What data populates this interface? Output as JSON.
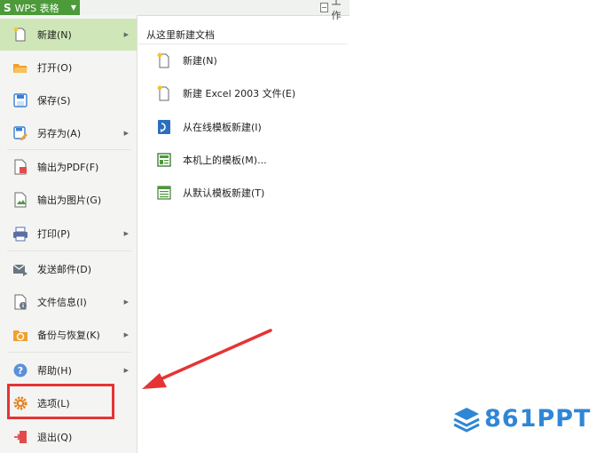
{
  "app": {
    "logo_letter": "S",
    "button_label": "WPS 表格",
    "right_label": "工作"
  },
  "menu": {
    "items": [
      {
        "label": "新建(N)",
        "icon": "new-doc-icon",
        "submenu": true
      },
      {
        "label": "打开(O)",
        "icon": "open-folder-icon",
        "submenu": false
      },
      {
        "label": "保存(S)",
        "icon": "save-icon",
        "submenu": false
      },
      {
        "label": "另存为(A)",
        "icon": "save-as-icon",
        "submenu": true
      },
      {
        "label": "输出为PDF(F)",
        "icon": "pdf-export-icon",
        "submenu": false
      },
      {
        "label": "输出为图片(G)",
        "icon": "image-export-icon",
        "submenu": false
      },
      {
        "label": "打印(P)",
        "icon": "printer-icon",
        "submenu": true
      },
      {
        "label": "发送邮件(D)",
        "icon": "mail-icon",
        "submenu": false
      },
      {
        "label": "文件信息(I)",
        "icon": "file-info-icon",
        "submenu": true
      },
      {
        "label": "备份与恢复(K)",
        "icon": "backup-icon",
        "submenu": true
      },
      {
        "label": "帮助(H)",
        "icon": "help-icon",
        "submenu": true
      },
      {
        "label": "选项(L)",
        "icon": "gear-icon",
        "submenu": false
      },
      {
        "label": "退出(Q)",
        "icon": "exit-icon",
        "submenu": false
      }
    ]
  },
  "panel": {
    "title": "从这里新建文档",
    "items": [
      {
        "label": "新建(N)",
        "icon": "new-doc-icon"
      },
      {
        "label": "新建 Excel 2003 文件(E)",
        "icon": "new-excel-icon"
      },
      {
        "label": "从在线模板新建(I)",
        "icon": "online-template-icon"
      },
      {
        "label": "本机上的模板(M)...",
        "icon": "local-template-icon"
      },
      {
        "label": "从默认模板新建(T)",
        "icon": "default-template-icon"
      }
    ]
  },
  "watermark": {
    "text": "861PPT",
    "color": "#2f86d6"
  },
  "colors": {
    "brand_green": "#4c9a39",
    "active_item": "#cfe7b8",
    "highlight_red": "#e53434"
  }
}
